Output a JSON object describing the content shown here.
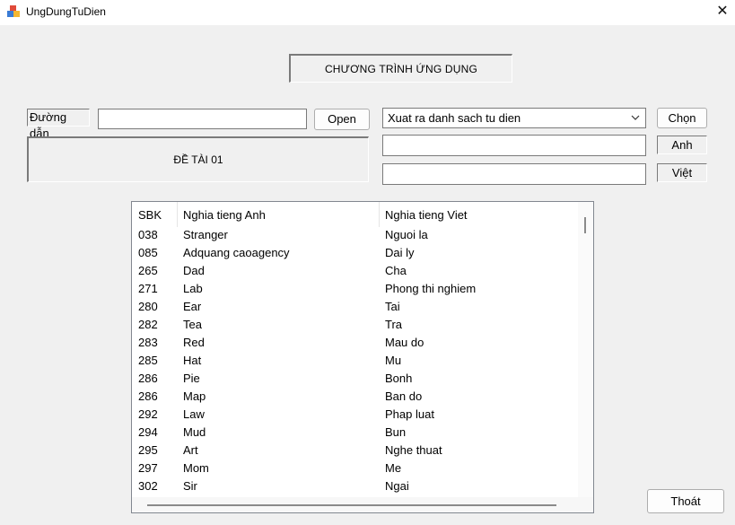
{
  "window": {
    "title": "UngDungTuDien",
    "close_glyph": "✕",
    "icon": "app-cubes-icon"
  },
  "header": {
    "title": "CHƯƠNG TRÌNH ỨNG DỤNG"
  },
  "path": {
    "label": "Đường dẫn",
    "value": "",
    "open_button": "Open"
  },
  "topic": {
    "text": "ĐỀ TÀI 01"
  },
  "action": {
    "selected": "Xuat ra danh sach tu dien",
    "choose_button": "Chọn",
    "english_label": "Anh",
    "vietnamese_label": "Việt",
    "english_value": "",
    "vietnamese_value": ""
  },
  "dictionary": {
    "columns": [
      "SBK",
      "Nghia tieng Anh",
      "Nghia tieng Viet"
    ],
    "rows": [
      [
        "038",
        "Stranger",
        "Nguoi la"
      ],
      [
        "085",
        "Adquang caoagency",
        "Dai ly"
      ],
      [
        "265",
        "Dad",
        "Cha"
      ],
      [
        "271",
        "Lab",
        "Phong thi nghiem"
      ],
      [
        "280",
        "Ear",
        "Tai"
      ],
      [
        "282",
        "Tea",
        "Tra"
      ],
      [
        "283",
        "Red",
        "Mau do"
      ],
      [
        "285",
        "Hat",
        "Mu"
      ],
      [
        "286",
        "Pie",
        "Bonh"
      ],
      [
        "286",
        "Map",
        "Ban do"
      ],
      [
        "292",
        "Law",
        "Phap luat"
      ],
      [
        "294",
        "Mud",
        "Bun"
      ],
      [
        "295",
        "Art",
        "Nghe thuat"
      ],
      [
        "297",
        "Mom",
        "Me"
      ],
      [
        "302",
        "Sir",
        "Ngai"
      ]
    ]
  },
  "footer": {
    "exit_button": "Thoát"
  }
}
